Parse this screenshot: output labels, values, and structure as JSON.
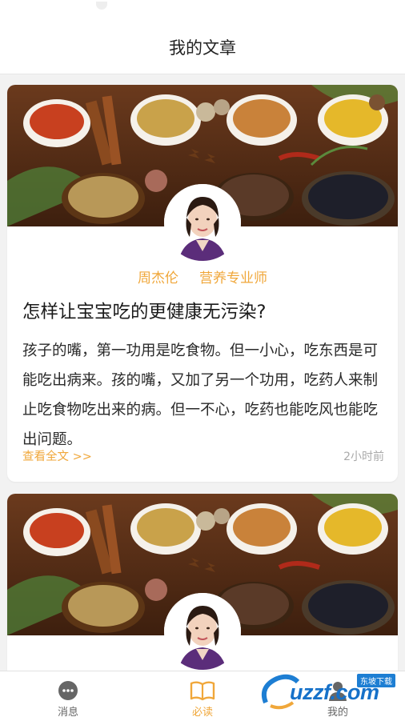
{
  "header": {
    "title": "我的文章"
  },
  "articles": [
    {
      "author": "周杰伦",
      "role": "营养专业师",
      "title": "怎样让宝宝吃的更健康无污染?",
      "excerpt": "孩子的嘴，第一功用是吃食物。但一小心，吃东西是可能吃出病来。孩的嘴，又加了另一个功用，吃药人来制止吃食物吃出来的病。但一不心，吃药也能吃风也能吃出问题。",
      "read_more": "查看全文 >>",
      "time": "2小时前"
    }
  ],
  "tabbar": {
    "items": [
      {
        "label": "消息",
        "icon": "chat-bubble-icon",
        "active": false
      },
      {
        "label": "必读",
        "icon": "open-book-icon",
        "active": true
      },
      {
        "label": "我的",
        "icon": "person-icon",
        "active": false
      }
    ]
  },
  "watermark": {
    "text": "uzzf.com",
    "badge": "东坡下载"
  },
  "colors": {
    "accent": "#f0a73a",
    "background": "#f2f2f2",
    "card": "#ffffff"
  }
}
